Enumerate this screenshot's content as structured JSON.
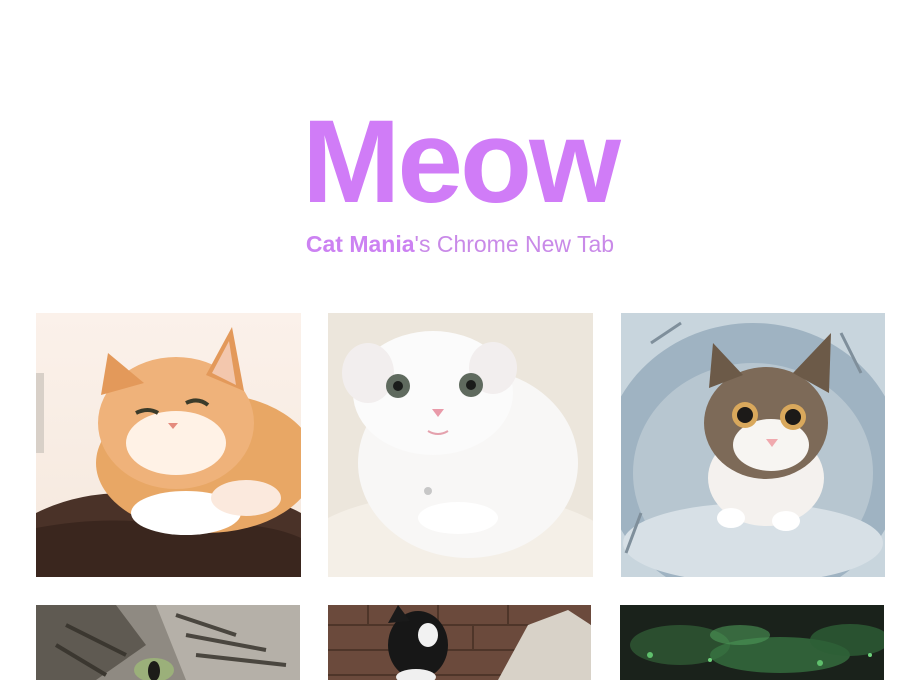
{
  "header": {
    "title": "Meow",
    "subtitle_brand": "Cat Mania",
    "subtitle_rest": "'s Chrome New Tab"
  },
  "colors": {
    "accent": "#d07cf7",
    "subtitle": "#c98ae8",
    "background": "#ffffff"
  },
  "gallery": {
    "photos": [
      {
        "subject": "orange tabby cat lying on brown blanket"
      },
      {
        "subject": "white fluffy kitten on white rug"
      },
      {
        "subject": "tabby and white kitten in play tunnel"
      },
      {
        "subject": "grey tabby cat close-up"
      },
      {
        "subject": "black and white cat on brick floor"
      },
      {
        "subject": "cat in dark green scene"
      }
    ]
  }
}
